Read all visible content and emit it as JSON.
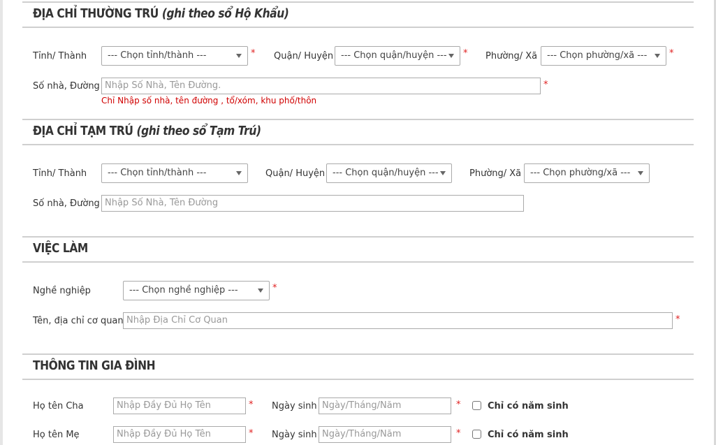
{
  "sections": {
    "permanent": {
      "title": "ĐỊA CHỈ THƯỜNG TRÚ",
      "hint": "(ghi theo sổ Hộ Khẩu)",
      "province_label": "Tỉnh/ Thành",
      "province_placeholder": "--- Chọn tỉnh/thành ---",
      "district_label": "Quận/ Huyện",
      "district_placeholder": "--- Chọn quận/huyện ---",
      "ward_label": "Phường/ Xã",
      "ward_placeholder": "--- Chọn phường/xã ---",
      "street_label": "Số nhà, Đường",
      "street_placeholder": "Nhập Số Nhà, Tên Đường.",
      "street_hint": "Chỉ Nhập số nhà, tên đường , tổ/xóm, khu phố/thôn",
      "required_mark": "*"
    },
    "temporary": {
      "title": "ĐỊA CHỈ TẠM TRÚ",
      "hint": "(ghi theo sổ Tạm Trú)",
      "province_label": "Tỉnh/ Thành",
      "province_placeholder": "--- Chọn tỉnh/thành ---",
      "district_label": "Quận/ Huyện",
      "district_placeholder": "--- Chọn quận/huyện ---",
      "ward_label": "Phường/ Xã",
      "ward_placeholder": "--- Chọn phường/xã ---",
      "street_label": "Số nhà, Đường",
      "street_placeholder": "Nhập Số Nhà, Tên Đường"
    },
    "job": {
      "title": "VIỆC LÀM",
      "occupation_label": "Nghề nghiệp",
      "occupation_placeholder": "--- Chọn nghề nghiệp ---",
      "company_label": "Tên, địa chỉ cơ quan",
      "company_placeholder": "Nhập Địa Chỉ Cơ Quan",
      "required_mark": "*"
    },
    "family": {
      "title": "THÔNG TIN GIA ĐÌNH",
      "father_label": "Họ tên Cha",
      "mother_label": "Họ tên Mẹ",
      "name_placeholder": "Nhập Đầy Đủ Họ Tên",
      "dob_label": "Ngày sinh",
      "dob_placeholder": "Ngày/Tháng/Năm",
      "year_only_label": "Chỉ có năm sinh",
      "required_mark": "*"
    }
  },
  "colors": {
    "required": "#e02020",
    "error_text": "#d00000",
    "divider": "#cfcfcf"
  }
}
